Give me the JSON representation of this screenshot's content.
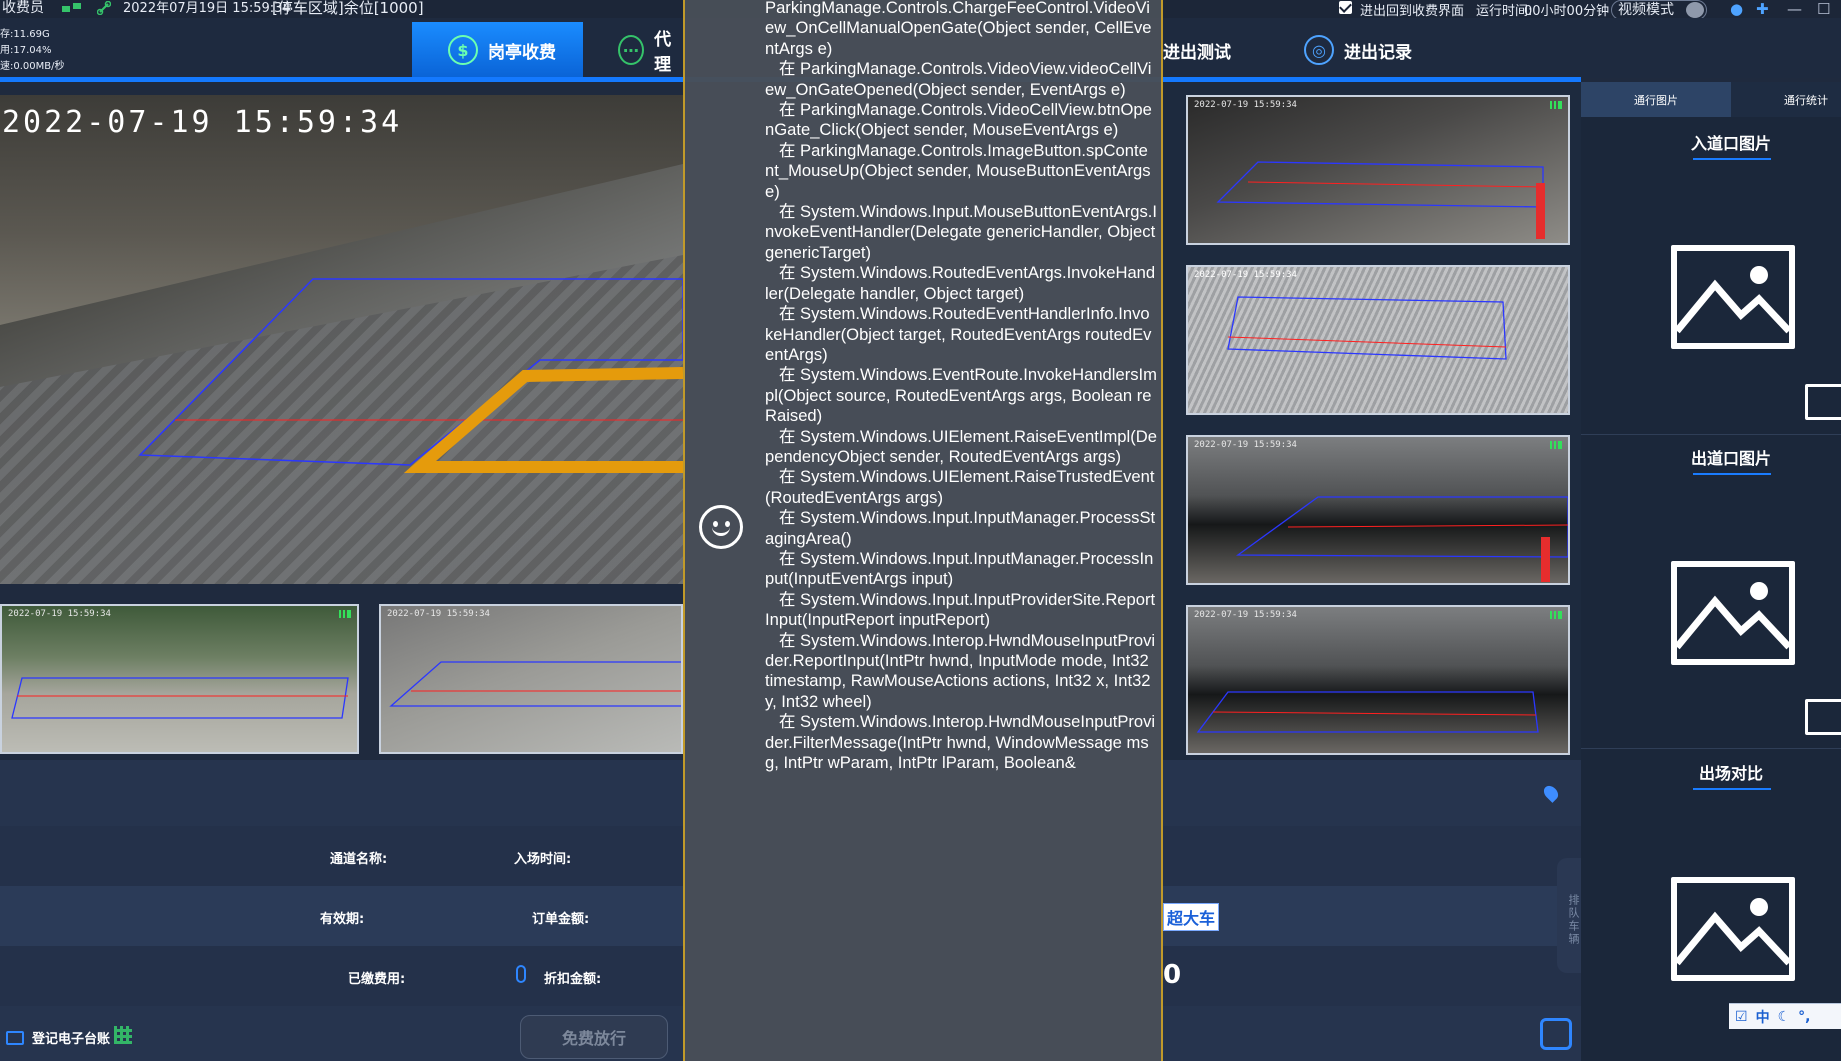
{
  "topbar": {
    "role": "收费员",
    "datetime": "2022年07月19日 15:59:34",
    "area_label": "[停车区域]余位[1000]",
    "sys_stats": [
      "存:11.69G",
      "用:17.04%",
      "速:0.00MB/秒"
    ],
    "return_checkbox_label": "进出回到收费界面",
    "runtime_label": "运行时间:",
    "runtime_value": "00小时00分钟",
    "mode_label": "视频模式"
  },
  "nav": {
    "tabs": [
      {
        "label": "岗亭收费",
        "icon": "dollar-icon",
        "active": true
      },
      {
        "label": "代理",
        "icon": "agent-icon",
        "active": false
      },
      {
        "label": "进出测试",
        "icon": "test-icon",
        "active": false
      },
      {
        "label": "进出记录",
        "icon": "record-icon",
        "active": false
      }
    ]
  },
  "cameras": {
    "main_timestamp": "2022-07-19  15:59:34",
    "small_timestamp": "2022-07-19 15:59:34"
  },
  "info": {
    "channel_name_label": "通道名称:",
    "entry_time_label": "入场时间:",
    "valid_period_label": "有效期:",
    "order_amount_label": "订单金额:",
    "paid_fee_label": "已缴费用:",
    "discount_amount_label": "折扣金额:",
    "register_label": "登记电子台账",
    "free_release_button": "免费放行",
    "oversize_badge": "超大车",
    "amount_digit": "0",
    "queue_label": "排队车辆"
  },
  "error_dialog": {
    "stack_trace": "ParkingManage.Controls.ChargeFeeControl.VideoView_OnCellManualOpenGate(Object sender, CellEventArgs e)\n   在 ParkingManage.Controls.VideoView.videoCellView_OnGateOpened(Object sender, EventArgs e)\n   在 ParkingManage.Controls.VideoCellView.btnOpenGate_Click(Object sender, MouseEventArgs e)\n   在 ParkingManage.Controls.ImageButton.spContent_MouseUp(Object sender, MouseButtonEventArgs e)\n   在 System.Windows.Input.MouseButtonEventArgs.InvokeEventHandler(Delegate genericHandler, Object genericTarget)\n   在 System.Windows.RoutedEventArgs.InvokeHandler(Delegate handler, Object target)\n   在 System.Windows.RoutedEventHandlerInfo.InvokeHandler(Object target, RoutedEventArgs routedEventArgs)\n   在 System.Windows.EventRoute.InvokeHandlersImpl(Object source, RoutedEventArgs args, Boolean reRaised)\n   在 System.Windows.UIElement.RaiseEventImpl(DependencyObject sender, RoutedEventArgs args)\n   在 System.Windows.UIElement.RaiseTrustedEvent(RoutedEventArgs args)\n   在 System.Windows.Input.InputManager.ProcessStagingArea()\n   在 System.Windows.Input.InputManager.ProcessInput(InputEventArgs input)\n   在 System.Windows.Input.InputProviderSite.ReportInput(InputReport inputReport)\n   在 System.Windows.Interop.HwndMouseInputProvider.ReportInput(IntPtr hwnd, InputMode mode, Int32 timestamp, RawMouseActions actions, Int32 x, Int32 y, Int32 wheel)\n   在 System.Windows.Interop.HwndMouseInputProvider.FilterMessage(IntPtr hwnd, WindowMessage msg, IntPtr wParam, IntPtr lParam, Boolean&"
  },
  "right_panel": {
    "tabs": [
      "通行图片",
      "通行统计"
    ],
    "entry_image_title": "入道口图片",
    "exit_image_title": "出道口图片",
    "compare_title": "出场对比",
    "ime": [
      "中"
    ]
  },
  "colors": {
    "accent": "#1479ff",
    "active_tab": "#0a63d6",
    "error_border": "#c19a2a"
  }
}
